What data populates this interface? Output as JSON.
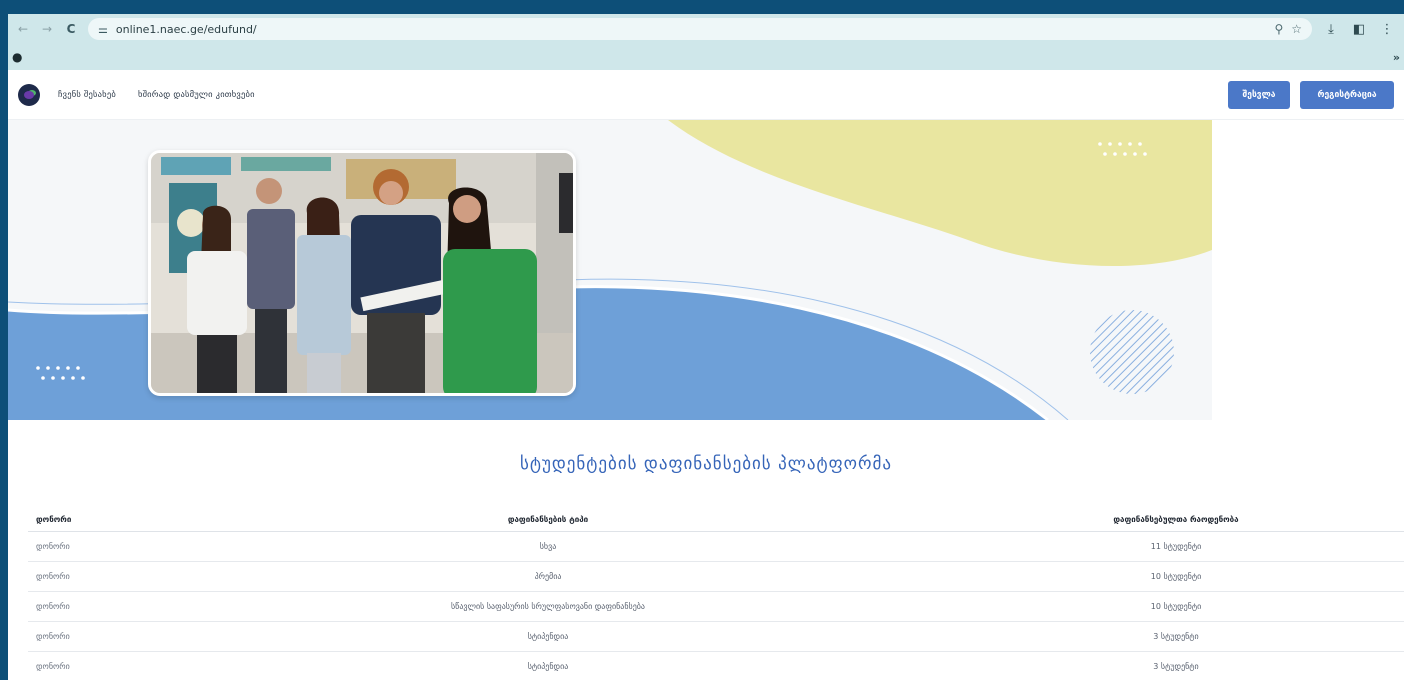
{
  "browser": {
    "url": "online1.naec.ge/edufund/",
    "bookmarks_more": "»"
  },
  "header": {
    "nav": [
      "ჩვენს შესახებ",
      "ხშირად დასმული კითხვები"
    ],
    "login_label": "შესვლა",
    "register_label": "რეგისტრაცია"
  },
  "platform": {
    "title": "სტუდენტების დაფინანსების პლატფორმა",
    "columns": [
      "დონორი",
      "დაფინანსების ტიპი",
      "დაფინანსებულთა რაოდენობა"
    ],
    "rows": [
      {
        "donor": "დონორი",
        "type": "სხვა",
        "count": "11 სტუდენტი"
      },
      {
        "donor": "დონორი",
        "type": "პრემია",
        "count": "10 სტუდენტი"
      },
      {
        "donor": "დონორი",
        "type": "სწავლის საფასურის სრულფასოვანი დაფინანსება",
        "count": "10 სტუდენტი"
      },
      {
        "donor": "დონორი",
        "type": "სტიპენდია",
        "count": "3 სტუდენტი"
      },
      {
        "donor": "დონორი",
        "type": "სტიპენდია",
        "count": "3 სტუდენტი"
      }
    ]
  },
  "colors": {
    "accent_blue": "#4b78c8",
    "hero_blue": "#6ea0d8",
    "hero_yellow": "#e9e6a0",
    "title_blue": "#3564b8"
  }
}
